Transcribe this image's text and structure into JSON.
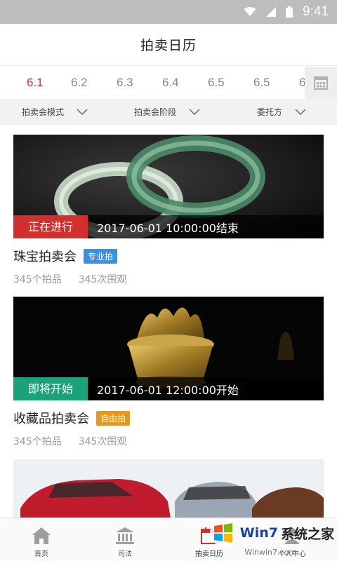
{
  "status_bar": {
    "time": "9:41"
  },
  "header": {
    "title": "拍卖日历"
  },
  "dates": [
    "6.1",
    "6.2",
    "6.3",
    "6.4",
    "6.5",
    "6.5",
    "6"
  ],
  "filters": [
    {
      "label": "拍卖会模式"
    },
    {
      "label": "拍卖会阶段"
    },
    {
      "label": "委托方"
    }
  ],
  "cards": [
    {
      "status": "正在进行",
      "status_color": "#d32f2f",
      "time": "2017-06-01   10:00:00结束",
      "title": "珠宝拍卖会",
      "tag": "专业拍",
      "tag_color": "#3d8fe0",
      "items": "345个拍品",
      "views": "345次围观"
    },
    {
      "status": "即将开始",
      "status_color": "#1aa37a",
      "time": "2017-06-01   12:00:00开始",
      "title": "收藏品拍卖会",
      "tag": "自由拍",
      "tag_color": "#e6981e",
      "items": "345个拍品",
      "views": "345次围观"
    }
  ],
  "nav": [
    {
      "label": "首页",
      "icon": "home-icon"
    },
    {
      "label": "司法",
      "icon": "court-icon"
    },
    {
      "label": "拍卖日历",
      "icon": "calendar-icon"
    },
    {
      "label": "个人中心",
      "icon": "user-icon"
    }
  ],
  "watermark": {
    "brand_a": "Win7",
    "brand_b": "系统之家",
    "url": "Winwin7.com"
  }
}
